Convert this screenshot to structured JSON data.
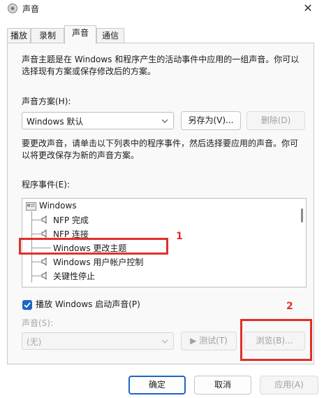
{
  "window": {
    "title": "声音",
    "close_glyph": "✕"
  },
  "tabs": [
    {
      "label": "播放",
      "active": false
    },
    {
      "label": "录制",
      "active": false
    },
    {
      "label": "声音",
      "active": true
    },
    {
      "label": "通信",
      "active": false
    }
  ],
  "sounds_tab": {
    "intro_line1": "声音主题是在 Windows 和程序产生的活动事件中应用的一组声音。你可以",
    "intro_line2": "选择现有方案或保存修改后的方案。",
    "scheme_label": "声音方案(H):",
    "scheme_value": "Windows 默认",
    "save_as_button": "另存为(V)...",
    "delete_button": "删除(D)",
    "instructions_line1": "要更改声音，请单击以下列表中的程序事件，然后选择要应用的声音。你可",
    "instructions_line2": "以将更改保存为新的声音方案。",
    "events_label": "程序事件(E):",
    "events": {
      "group": "Windows",
      "items": [
        {
          "label": "NFP 完成",
          "has_sound": true
        },
        {
          "label": "NFP 连接",
          "has_sound": true
        },
        {
          "label": "Windows 更改主题",
          "has_sound": false
        },
        {
          "label": "Windows 用户帐户控制",
          "has_sound": true
        },
        {
          "label": "关键性停止",
          "has_sound": true
        }
      ]
    },
    "startup_sound_label": "播放 Windows 启动声音(P)",
    "startup_sound_checked": true,
    "sounds_label": "声音(S):",
    "sound_value": "(无)",
    "test_button": "▶ 测试(T)",
    "browse_button": "浏览(B)..."
  },
  "footer": {
    "ok": "确定",
    "cancel": "取消",
    "apply": "应用(A)"
  },
  "annotations": {
    "marker_1": "1",
    "marker_2": "2",
    "color": "#e0302b"
  },
  "colors": {
    "accent": "#1a66c9",
    "disabled_text": "#a6a6a6"
  },
  "icons": {
    "window": "speaker-icon",
    "event_sound": "speaker-icon",
    "group": "windows-group-icon"
  }
}
